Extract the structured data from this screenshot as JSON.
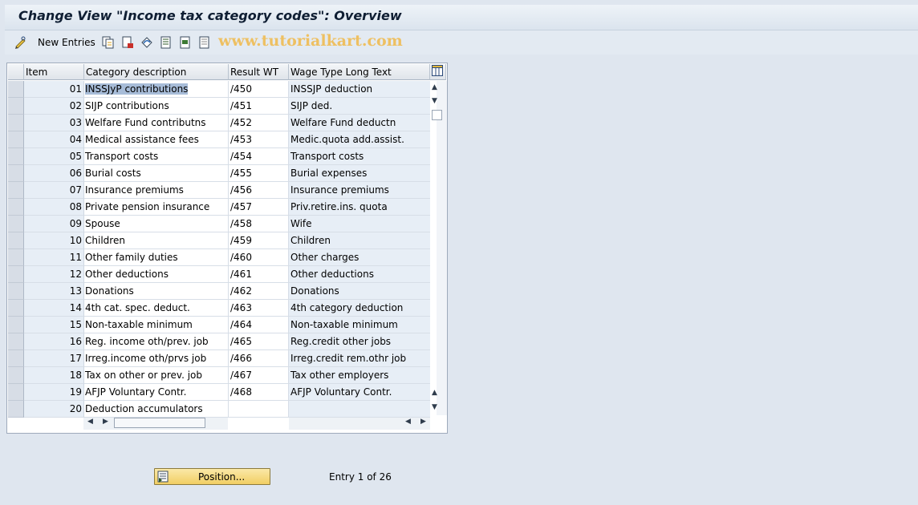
{
  "title": "Change View \"Income tax category codes\": Overview",
  "toolbar": {
    "new_entries_label": "New Entries",
    "icons": [
      "edit-glasses-icon",
      "copy-icon",
      "delete-icon",
      "undo-icon",
      "select-all-icon",
      "select-block-icon",
      "deselect-all-icon"
    ]
  },
  "watermark": "www.tutorialkart.com",
  "table": {
    "headers": {
      "item": "Item",
      "category": "Category description",
      "result": "Result WT",
      "long": "Wage Type Long Text"
    },
    "rows": [
      {
        "item": "01",
        "category": "INSSJyP contributions",
        "result": "/450",
        "long": "INSSJP deduction"
      },
      {
        "item": "02",
        "category": "SIJP contributions",
        "result": "/451",
        "long": "SIJP ded."
      },
      {
        "item": "03",
        "category": "Welfare Fund contributns",
        "result": "/452",
        "long": "Welfare Fund deductn"
      },
      {
        "item": "04",
        "category": "Medical assistance fees",
        "result": "/453",
        "long": "Medic.quota add.assist."
      },
      {
        "item": "05",
        "category": "Transport costs",
        "result": "/454",
        "long": "Transport costs"
      },
      {
        "item": "06",
        "category": "Burial costs",
        "result": "/455",
        "long": "Burial expenses"
      },
      {
        "item": "07",
        "category": "Insurance premiums",
        "result": "/456",
        "long": "Insurance premiums"
      },
      {
        "item": "08",
        "category": "Private pension insurance",
        "result": "/457",
        "long": "Priv.retire.ins. quota"
      },
      {
        "item": "09",
        "category": "Spouse",
        "result": "/458",
        "long": "Wife"
      },
      {
        "item": "10",
        "category": "Children",
        "result": "/459",
        "long": "Children"
      },
      {
        "item": "11",
        "category": "Other family duties",
        "result": "/460",
        "long": "Other charges"
      },
      {
        "item": "12",
        "category": "Other deductions",
        "result": "/461",
        "long": "Other deductions"
      },
      {
        "item": "13",
        "category": "Donations",
        "result": "/462",
        "long": "Donations"
      },
      {
        "item": "14",
        "category": "4th cat. spec. deduct.",
        "result": "/463",
        "long": "4th category deduction"
      },
      {
        "item": "15",
        "category": "Non-taxable minimum",
        "result": "/464",
        "long": "Non-taxable minimum"
      },
      {
        "item": "16",
        "category": "Reg. income oth/prev. job",
        "result": "/465",
        "long": "Reg.credit other jobs"
      },
      {
        "item": "17",
        "category": "Irreg.income oth/prvs job",
        "result": "/466",
        "long": "Irreg.credit rem.othr job"
      },
      {
        "item": "18",
        "category": "Tax on other or prev. job",
        "result": "/467",
        "long": "Tax other employers"
      },
      {
        "item": "19",
        "category": "AFJP Voluntary Contr.",
        "result": "/468",
        "long": "AFJP Voluntary Contr."
      },
      {
        "item": "20",
        "category": "Deduction accumulators",
        "result": "",
        "long": ""
      }
    ]
  },
  "position_button_label": "Position...",
  "entry_text": "Entry 1 of 26",
  "colors": {
    "background": "#dfe6ef",
    "title_text": "#0f1e33",
    "button_yellow": "#f1ce63",
    "cell_highlight": "#a7bcd8"
  }
}
